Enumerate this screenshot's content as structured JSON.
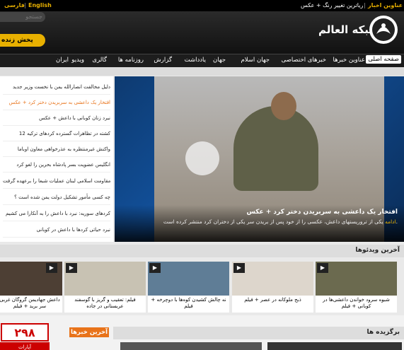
{
  "topbar": {
    "lang_fa": "فارسی",
    "lang_en": "English",
    "headlines_label": "عناوین اخبار",
    "ticker": "ریاترین تغییر رنگ + عکس"
  },
  "header": {
    "search_placeholder": "جستجو",
    "live_button": "پخش زنده",
    "logo_text": "شبکه العالم"
  },
  "nav": {
    "items": [
      "صفحه اصلی",
      "عناوین خبرها",
      "خبرهای اختصاصی",
      "جهان اسلام",
      "جهان",
      "یادداشت",
      "گزارش",
      "روزنامه ها",
      "گالری",
      "ویدیو",
      "ایران"
    ]
  },
  "news_list": [
    {
      "text": "دلیل مخالفت انصارالله یمن با نخست وزیر جدید",
      "highlight": false
    },
    {
      "text": "افتخار یک داعشی به سربریدن دختر کرد + عکس",
      "highlight": true
    },
    {
      "text": "نبرد زنان کوبانی با داعش + عکس",
      "highlight": false
    },
    {
      "text": "12 کشته در تظاهرات گسترده کردهای ترکیه",
      "highlight": false
    },
    {
      "text": "واکنش غیرمنتظره به عذرخواهی معاون اوباما",
      "highlight": false
    },
    {
      "text": "انگلیس عضویت بسر پادشاه بحرین را لغو کرد",
      "highlight": false
    },
    {
      "text": "مقاومت اسلامی لبنان عملیات شبعا را برعهده گرفت",
      "highlight": false
    },
    {
      "text": "چه کسی مأمور تشکیل دولت یمن شده است ؟",
      "highlight": false
    },
    {
      "text": "کردهای سوریه: نبرد با داعش را به آنکارا می کشیم",
      "highlight": false
    },
    {
      "text": "نبرد حیاتی کردها با داعش در کوبانی",
      "highlight": false
    }
  ],
  "hero": {
    "title": "افتخار یک داعشی به سربریدن دختر کرد + عکس",
    "description": "یکی از تروریستهای داعش، عکسی را از خود پس از بریدن سر یکی از دختران کرد منتشر کرده است.",
    "more_label": "ادامه"
  },
  "videos": {
    "section_title": "آخرین ویدئوها",
    "items": [
      {
        "caption": "شبوه سرود خواندن داعشی‌ها در کوبانی + فیلم",
        "color": "#6b6a4f"
      },
      {
        "caption": "ذبح ملوکانه در عصر + فیلم",
        "color": "#ddd6cc"
      },
      {
        "caption": "نه چالش کشیدن کوه‌ها با دوچرخه + فیلم",
        "color": "#5f7d96"
      },
      {
        "caption": "فیلم: تعقیب و گریز با گوسفند عربستانی در جاده",
        "color": "#c8c2b3"
      },
      {
        "caption": "داعش جهادیمن گروگان غربی سر برید + فیلم",
        "color": "#4d3f34"
      }
    ]
  },
  "bottom": {
    "latest_news_label": "آخرین خبرها",
    "featured_label": "برگزیده ها",
    "aparat_logo_text": "آپارات"
  },
  "colors": {
    "accent_orange": "#e8731a",
    "live_yellow": "#e8b000",
    "nav_dark": "#1d1d1d"
  }
}
